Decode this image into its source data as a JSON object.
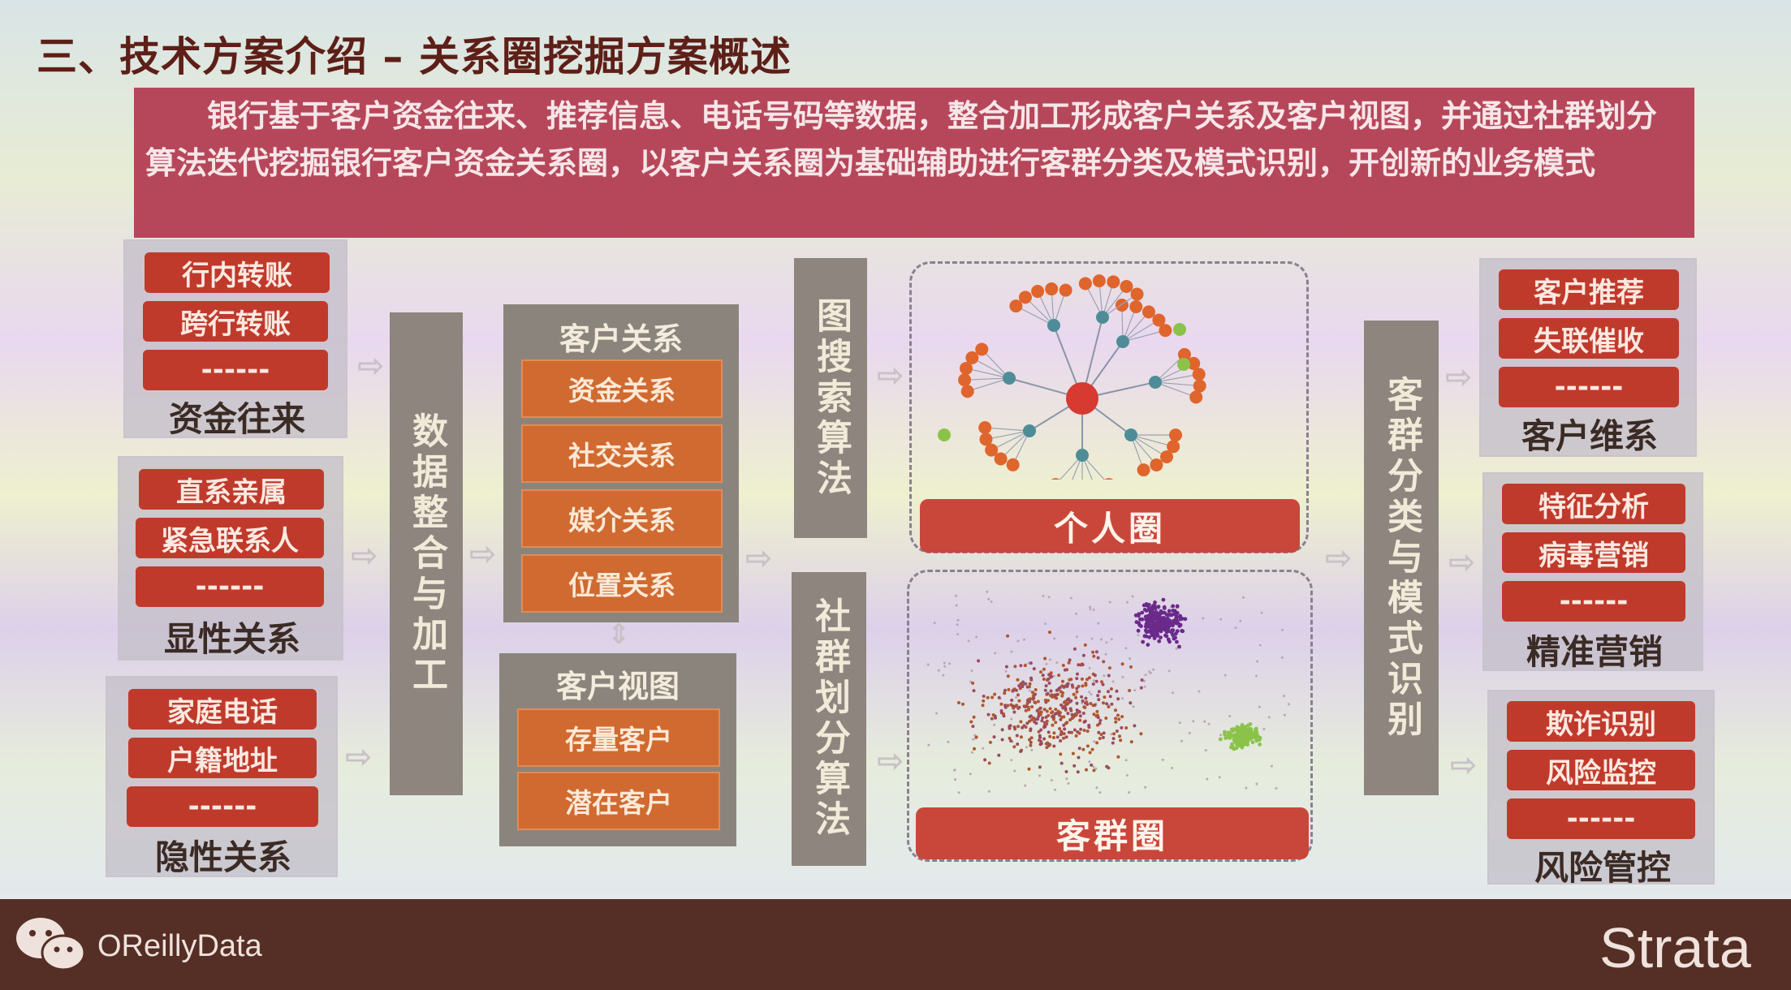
{
  "title": "三、技术方案介绍 – 关系圈挖掘方案概述",
  "banner": "　　银行基于客户资金往来、推荐信息、电话号码等数据，整合加工形成客户关系及客户视图，并通过社群划分算法迭代挖掘银行客户资金关系圈，以客户关系圈为基础辅助进行客群分类及模式识别，开创新的业务模式",
  "input_groups": [
    {
      "items": [
        "行内转账",
        "跨行转账",
        "------"
      ],
      "label": "资金往来"
    },
    {
      "items": [
        "直系亲属",
        "紧急联系人",
        "------"
      ],
      "label": "显性关系"
    },
    {
      "items": [
        "家庭电话",
        "户籍地址",
        "------"
      ],
      "label": "隐性关系"
    }
  ],
  "process_bar": "数据整合与加工",
  "customer_relation": {
    "title": "客户关系",
    "items": [
      "资金关系",
      "社交关系",
      "媒介关系",
      "位置关系"
    ]
  },
  "customer_view": {
    "title": "客户视图",
    "items": [
      "存量客户",
      "潜在客户"
    ]
  },
  "algo_search": "图搜索算法",
  "algo_community": "社群划分算法",
  "personal_circle": "个人圈",
  "group_circle": "客群圈",
  "classify_bar": "客群分类与模式识别",
  "output_groups": [
    {
      "items": [
        "客户推荐",
        "失联催收",
        "------"
      ],
      "label": "客户维系"
    },
    {
      "items": [
        "特征分析",
        "病毒营销",
        "------"
      ],
      "label": "精准营销"
    },
    {
      "items": [
        "欺诈识别",
        "风险监控",
        "------"
      ],
      "label": "风险管控"
    }
  ],
  "footer": {
    "brand": "OReillyData",
    "logo": "Strata"
  },
  "icons": {
    "chat": "wechat-icon"
  },
  "colors": {
    "banner": "#b6475a",
    "pill": "#c03a2c",
    "orange": "#d06a30",
    "node": "#e0652c",
    "hub": "#d63a30",
    "teal": "#4e8d98",
    "green": "#8bc34a",
    "purple": "#6a2a8a",
    "footer": "#552e25"
  }
}
